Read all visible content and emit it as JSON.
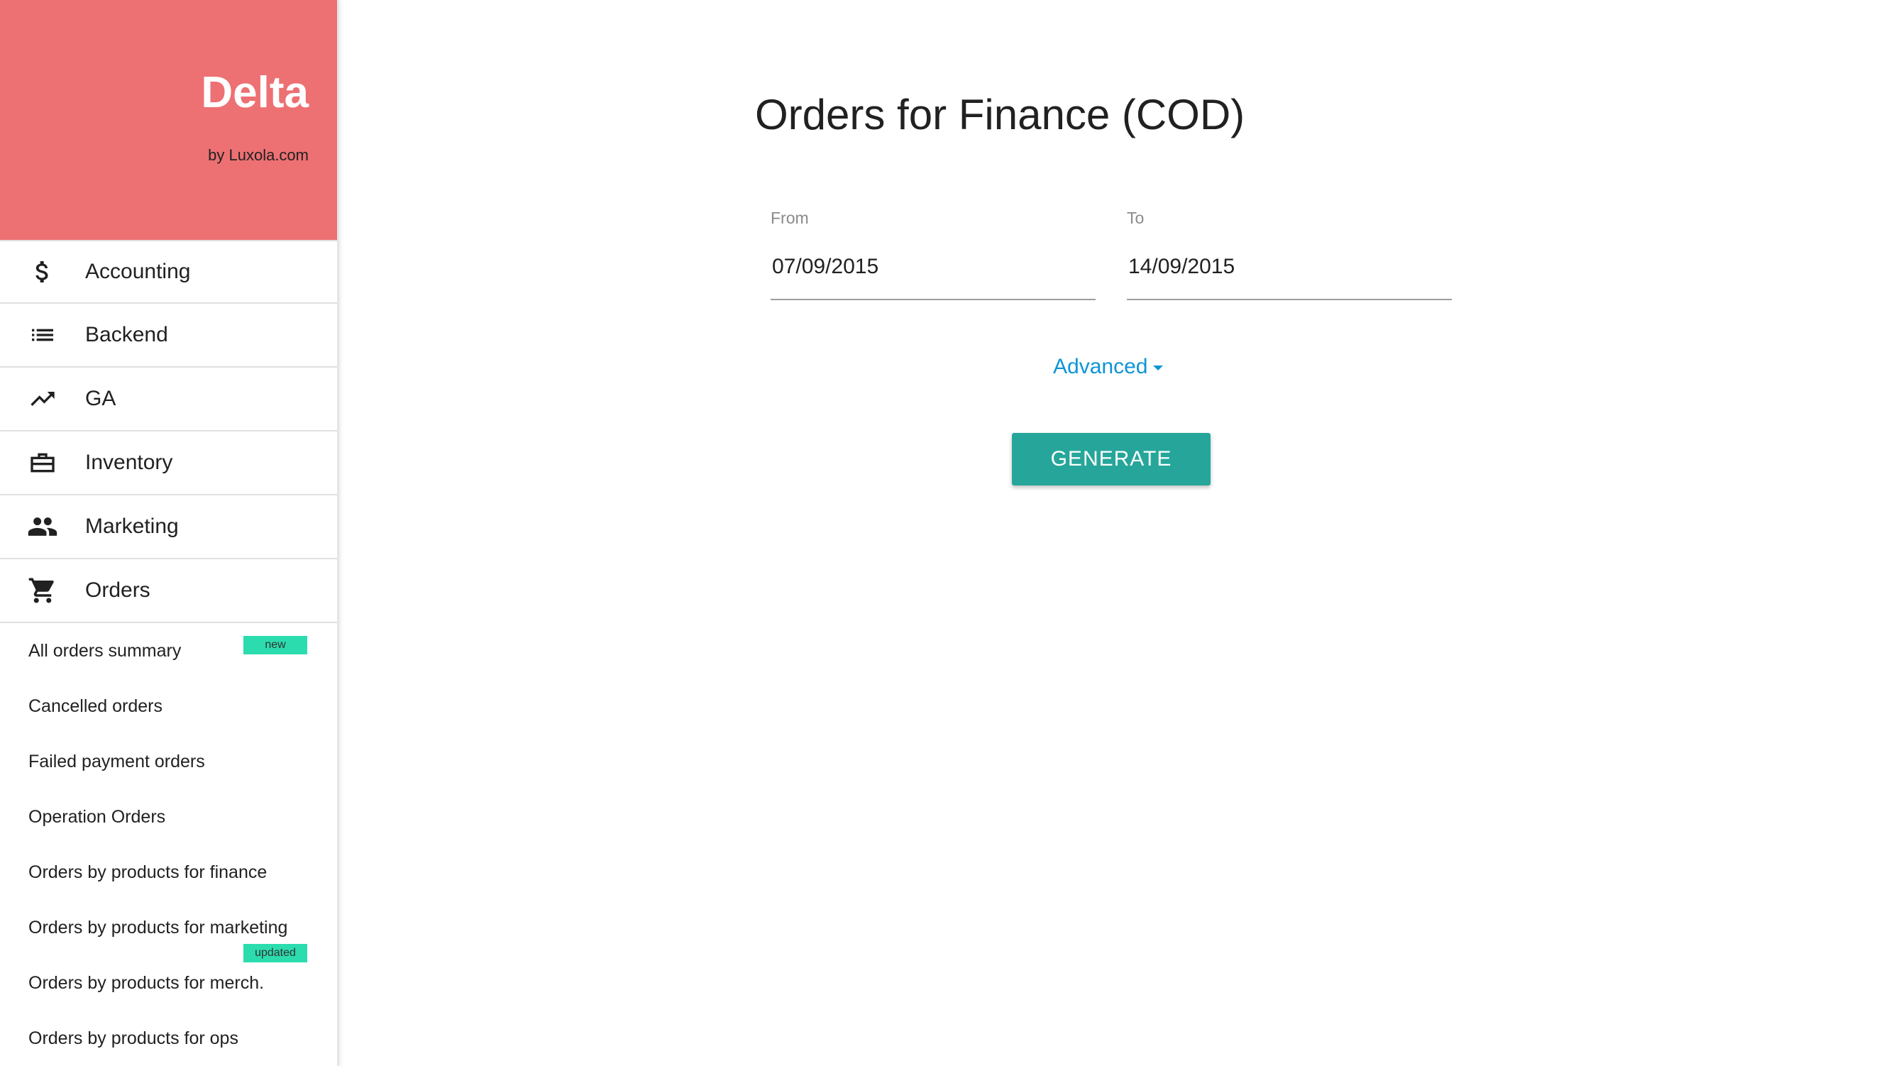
{
  "brand": {
    "title": "Delta",
    "subtitle": "by Luxola.com",
    "color": "#ed7073"
  },
  "sidebar": {
    "items": [
      {
        "label": "Accounting",
        "icon": "dollar-icon"
      },
      {
        "label": "Backend",
        "icon": "list-icon"
      },
      {
        "label": "GA",
        "icon": "trending-up-icon"
      },
      {
        "label": "Inventory",
        "icon": "briefcase-icon"
      },
      {
        "label": "Marketing",
        "icon": "people-icon"
      },
      {
        "label": "Orders",
        "icon": "cart-icon"
      }
    ],
    "orders_subitems": [
      {
        "label": "All orders summary",
        "badge": "new"
      },
      {
        "label": "Cancelled orders"
      },
      {
        "label": "Failed payment orders"
      },
      {
        "label": "Operation Orders"
      },
      {
        "label": "Orders by products for finance"
      },
      {
        "label": "Orders by products for marketing",
        "badge": "updated"
      },
      {
        "label": "Orders by products for merch."
      },
      {
        "label": "Orders by products for ops"
      }
    ],
    "badge_color": "#2bdcae"
  },
  "main": {
    "title": "Orders for Finance (COD)",
    "from": {
      "label": "From",
      "value": "07/09/2015"
    },
    "to": {
      "label": "To",
      "value": "14/09/2015"
    },
    "advanced_label": "Advanced",
    "generate_label": "GENERATE",
    "accent_color": "#0d95d6",
    "button_color": "#26a69a"
  }
}
